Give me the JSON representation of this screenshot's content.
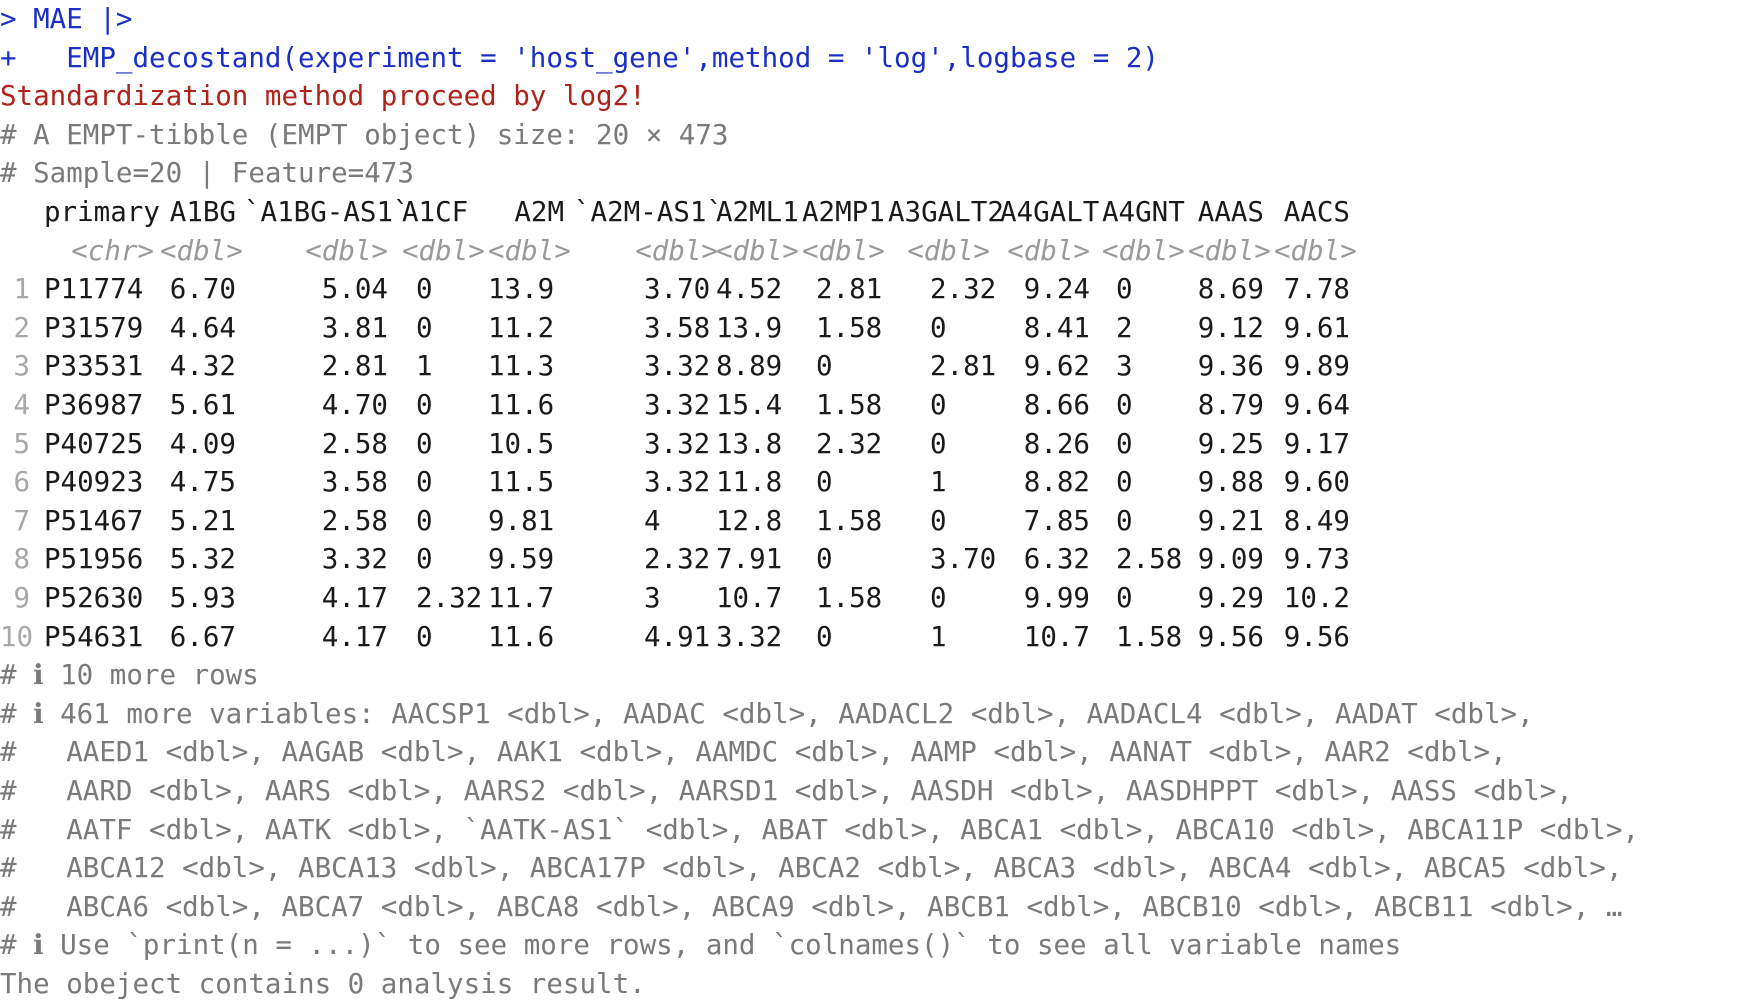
{
  "console": {
    "prompt_lines": [
      {
        "prompt": ">",
        "code": " MAE |>"
      },
      {
        "prompt": "+",
        "code": "   EMP_decostand(experiment = 'host_gene',method = 'log',logbase = 2)"
      }
    ],
    "message": "Standardization method proceed by log2!",
    "header_lines": [
      "# A EMPT-tibble (EMPT object) size: 20 × 473",
      "# Sample=20 | Feature=473"
    ],
    "columns": [
      "primary",
      "A1BG",
      "`A1BG-AS1`",
      "A1CF",
      "A2M",
      "`A2M-AS1`",
      "A2ML1",
      "A2MP1",
      "A3GALT2",
      "A4GALT",
      "A4GNT",
      "AAAS",
      "AACS"
    ],
    "types": [
      "<chr>",
      "<dbl>",
      "<dbl>",
      "<dbl>",
      "<dbl>",
      "<dbl>",
      "<dbl>",
      "<dbl>",
      "<dbl>",
      "<dbl>",
      "<dbl>",
      "<dbl>",
      "<dbl>"
    ],
    "rows": [
      {
        "n": "1",
        "cells": [
          "P11774",
          "6.70",
          "5.04",
          "0",
          "13.9",
          "3.70",
          "4.52",
          "2.81",
          "2.32",
          "9.24",
          "0",
          "8.69",
          "7.78"
        ]
      },
      {
        "n": "2",
        "cells": [
          "P31579",
          "4.64",
          "3.81",
          "0",
          "11.2",
          "3.58",
          "13.9",
          "1.58",
          "0",
          "8.41",
          "2",
          "9.12",
          "9.61"
        ]
      },
      {
        "n": "3",
        "cells": [
          "P33531",
          "4.32",
          "2.81",
          "1",
          "11.3",
          "3.32",
          "8.89",
          "0",
          "2.81",
          "9.62",
          "3",
          "9.36",
          "9.89"
        ]
      },
      {
        "n": "4",
        "cells": [
          "P36987",
          "5.61",
          "4.70",
          "0",
          "11.6",
          "3.32",
          "15.4",
          "1.58",
          "0",
          "8.66",
          "0",
          "8.79",
          "9.64"
        ]
      },
      {
        "n": "5",
        "cells": [
          "P40725",
          "4.09",
          "2.58",
          "0",
          "10.5",
          "3.32",
          "13.8",
          "2.32",
          "0",
          "8.26",
          "0",
          "9.25",
          "9.17"
        ]
      },
      {
        "n": "6",
        "cells": [
          "P40923",
          "4.75",
          "3.58",
          "0",
          "11.5",
          "3.32",
          "11.8",
          "0",
          "1",
          "8.82",
          "0",
          "9.88",
          "9.60"
        ]
      },
      {
        "n": "7",
        "cells": [
          "P51467",
          "5.21",
          "2.58",
          "0",
          "9.81",
          "4",
          "12.8",
          "1.58",
          "0",
          "7.85",
          "0",
          "9.21",
          "8.49"
        ]
      },
      {
        "n": "8",
        "cells": [
          "P51956",
          "5.32",
          "3.32",
          "0",
          "9.59",
          "2.32",
          "7.91",
          "0",
          "3.70",
          "6.32",
          "2.58",
          "9.09",
          "9.73"
        ]
      },
      {
        "n": "9",
        "cells": [
          "P52630",
          "5.93",
          "4.17",
          "2.32",
          "11.7",
          "3",
          "10.7",
          "1.58",
          "0",
          "9.99",
          "0",
          "9.29",
          "10.2"
        ]
      },
      {
        "n": "10",
        "cells": [
          "P54631",
          "6.67",
          "4.17",
          "0",
          "11.6",
          "4.91",
          "3.32",
          "0",
          "1",
          "10.7",
          "1.58",
          "9.56",
          "9.56"
        ]
      }
    ],
    "footer_lines": [
      "# ℹ 10 more rows",
      "# ℹ 461 more variables: AACSP1 <dbl>, AADAC <dbl>, AADACL2 <dbl>, AADACL4 <dbl>, AADAT <dbl>,",
      "#   AAED1 <dbl>, AAGAB <dbl>, AAK1 <dbl>, AAMDC <dbl>, AAMP <dbl>, AANAT <dbl>, AAR2 <dbl>,",
      "#   AARD <dbl>, AARS <dbl>, AARS2 <dbl>, AARSD1 <dbl>, AASDH <dbl>, AASDHPPT <dbl>, AASS <dbl>,",
      "#   AATF <dbl>, AATK <dbl>, `AATK-AS1` <dbl>, ABAT <dbl>, ABCA1 <dbl>, ABCA10 <dbl>, ABCA11P <dbl>,",
      "#   ABCA12 <dbl>, ABCA13 <dbl>, ABCA17P <dbl>, ABCA2 <dbl>, ABCA3 <dbl>, ABCA4 <dbl>, ABCA5 <dbl>,",
      "#   ABCA6 <dbl>, ABCA7 <dbl>, ABCA8 <dbl>, ABCA9 <dbl>, ABCB1 <dbl>, ABCB10 <dbl>, ABCB11 <dbl>, …",
      "# ℹ Use `print(n = ...)` to see more rows, and `colnames()` to see all variable names"
    ],
    "result_line": "The obeject contains 0 analysis result.",
    "colors": {
      "command": "#1b2fc7",
      "message": "#b0221c",
      "comment": "#7a7a7a"
    }
  }
}
